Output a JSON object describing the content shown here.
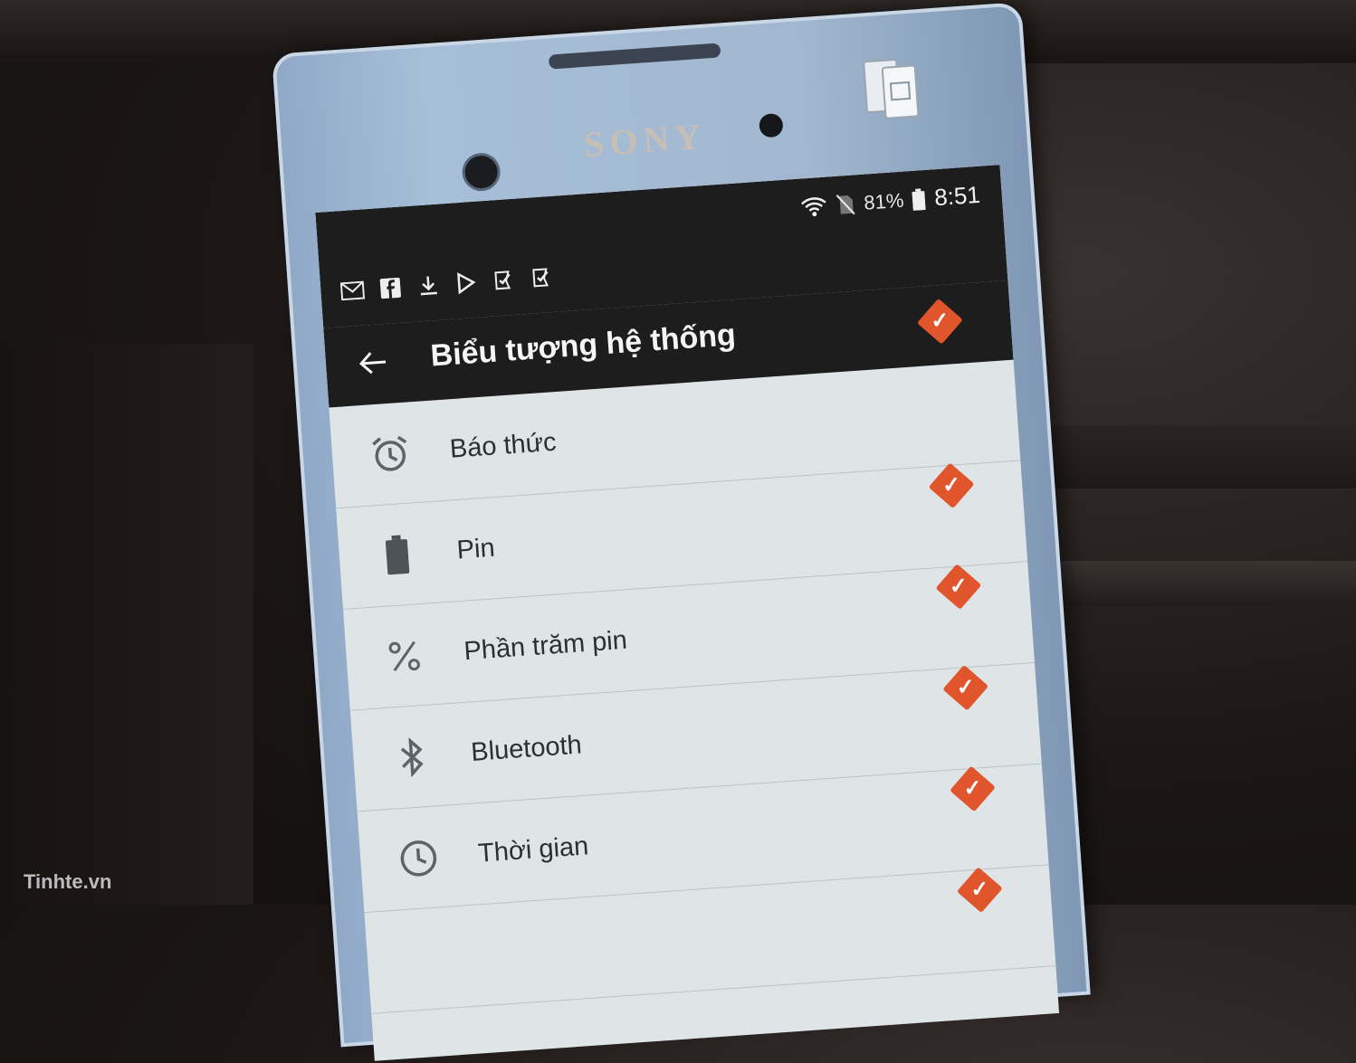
{
  "device": {
    "brand": "SONY"
  },
  "status_bar": {
    "notification_icons": [
      "gmail-icon",
      "facebook-icon",
      "download-icon",
      "play-store-icon",
      "task-check-icon",
      "task-check-icon"
    ],
    "battery_percent": "81%",
    "time": "8:51"
  },
  "toolbar": {
    "title": "Biểu tượng hệ thống"
  },
  "items": [
    {
      "label": "Báo thức",
      "icon": "alarm-clock-icon",
      "checked": true
    },
    {
      "label": "Pin",
      "icon": "battery-icon",
      "checked": true
    },
    {
      "label": "Phần trăm pin",
      "icon": "percent-icon",
      "checked": true
    },
    {
      "label": "Bluetooth",
      "icon": "bluetooth-icon",
      "checked": true
    },
    {
      "label": "Thời gian",
      "icon": "clock-icon",
      "checked": true
    }
  ],
  "accent_color": "#e0552c",
  "watermark": "Tinhte.vn"
}
